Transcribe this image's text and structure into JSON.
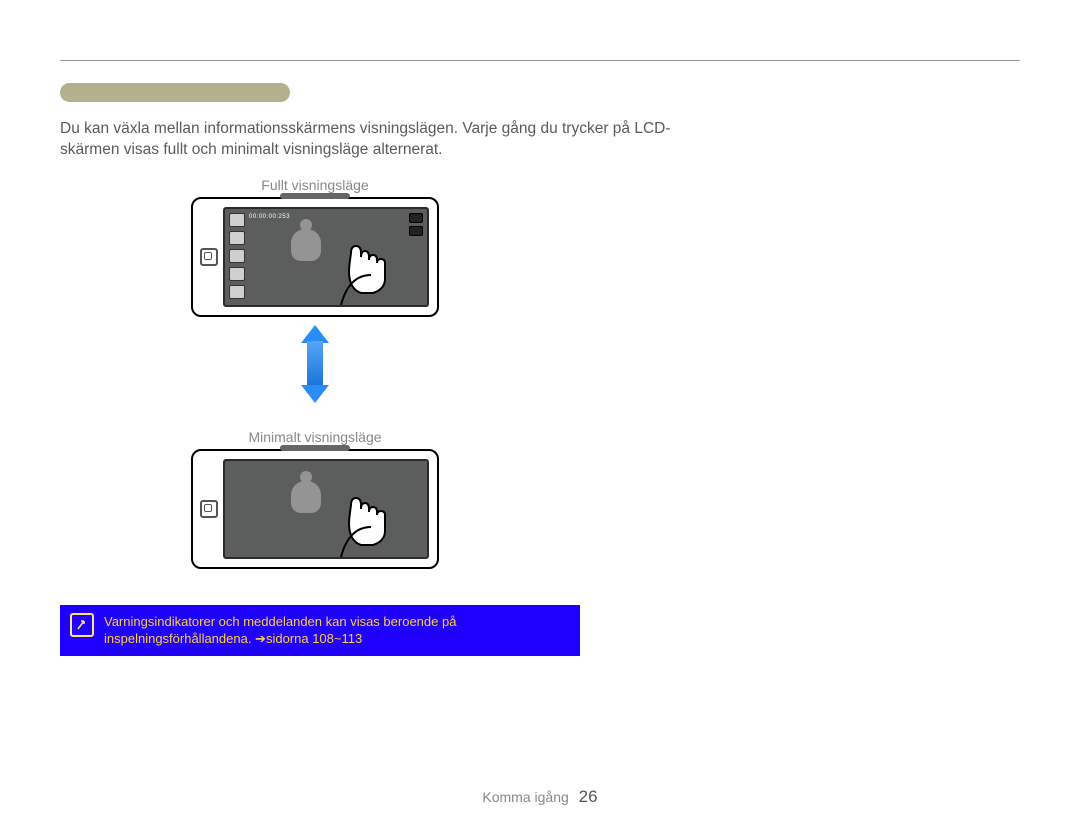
{
  "body_text": "Du kan växla mellan informationsskärmens visningslägen. Varje gång du trycker på LCD-skärmen visas fullt och minimalt visningsläge alternerat.",
  "captions": {
    "full": "Fullt visningsläge",
    "minimal": "Minimalt visningsläge"
  },
  "device": {
    "counter": "00:00:00:253"
  },
  "note": {
    "icon_label": "note-icon",
    "text": "Varningsindikatorer och meddelanden kan visas beroende på inspelningsförhållandena. ➔sidorna 108~113"
  },
  "footer": {
    "section": "Komma igång",
    "page": "26"
  }
}
